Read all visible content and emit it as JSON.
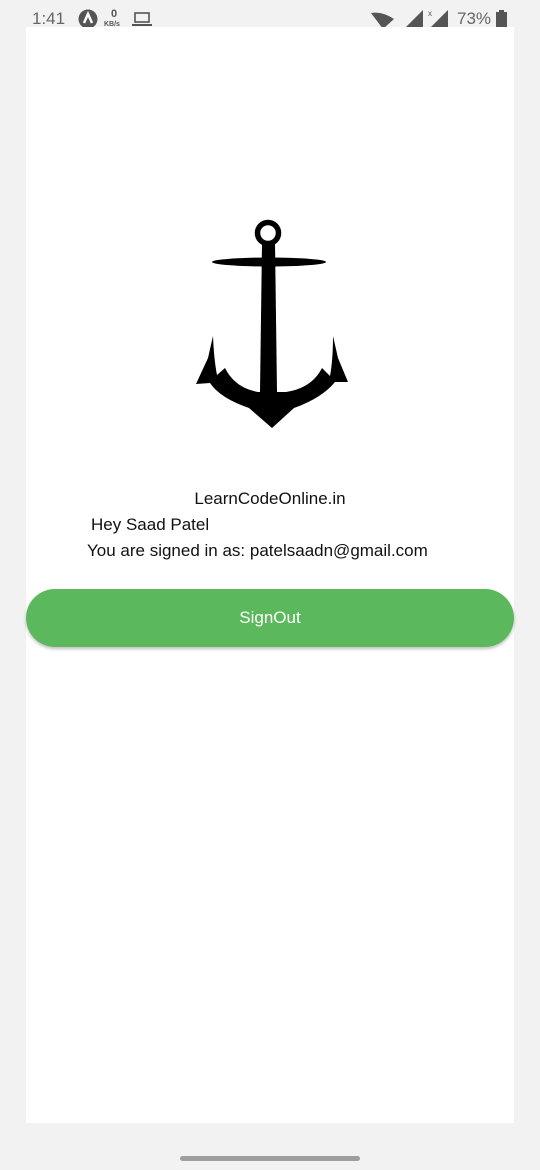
{
  "status_bar": {
    "time": "1:41",
    "net_speed_value": "0",
    "net_speed_unit": "KB/s",
    "battery": "73%"
  },
  "app": {
    "logo_icon": "anchor-icon",
    "brand": "LearnCodeOnline.in",
    "greeting": "Hey Saad Patel",
    "signed_in_text": "You are signed in as: patelsaadn@gmail.com",
    "signout_label": "SignOut",
    "button_color": "#5cb85c"
  }
}
